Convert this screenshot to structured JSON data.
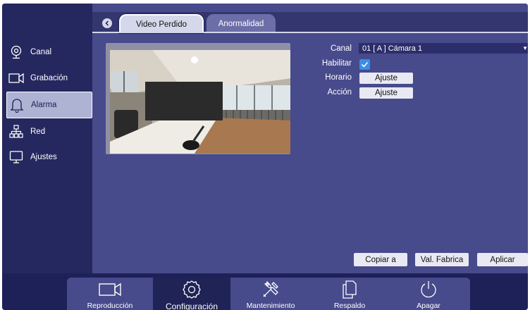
{
  "sidebar": {
    "items": [
      {
        "label": "Canal",
        "icon": "camera-lens-icon"
      },
      {
        "label": "Grabación",
        "icon": "video-camera-icon"
      },
      {
        "label": "Alarma",
        "icon": "bell-icon",
        "active": true
      },
      {
        "label": "Red",
        "icon": "network-icon"
      },
      {
        "label": "Ajustes",
        "icon": "monitor-icon"
      }
    ]
  },
  "tabs": [
    {
      "label": "Video Perdido",
      "active": true
    },
    {
      "label": "Anormalidad",
      "active": false
    }
  ],
  "form": {
    "canal_label": "Canal",
    "canal_value": "01 [ A ] Cámara 1",
    "habilitar_label": "Habilitar",
    "habilitar_checked": true,
    "horario_label": "Horario",
    "horario_button": "Ajuste",
    "accion_label": "Acción",
    "accion_button": "Ajuste"
  },
  "footer": {
    "copy_label": "Copiar a",
    "factory_label": "Val. Fabrica",
    "apply_label": "Aplicar"
  },
  "bottom_nav": [
    {
      "label": "Reproducción",
      "icon": "video-camera-icon"
    },
    {
      "label": "Configuración",
      "icon": "gear-icon",
      "active": true
    },
    {
      "label": "Mantenimiento",
      "icon": "tools-icon"
    },
    {
      "label": "Respaldo",
      "icon": "copy-icon"
    },
    {
      "label": "Apagar",
      "icon": "power-icon"
    }
  ],
  "colors": {
    "background": "#1e2158",
    "panel": "#474a8b",
    "accent": "#3a8ee8",
    "active_sidebar": "#aeb2d3"
  }
}
